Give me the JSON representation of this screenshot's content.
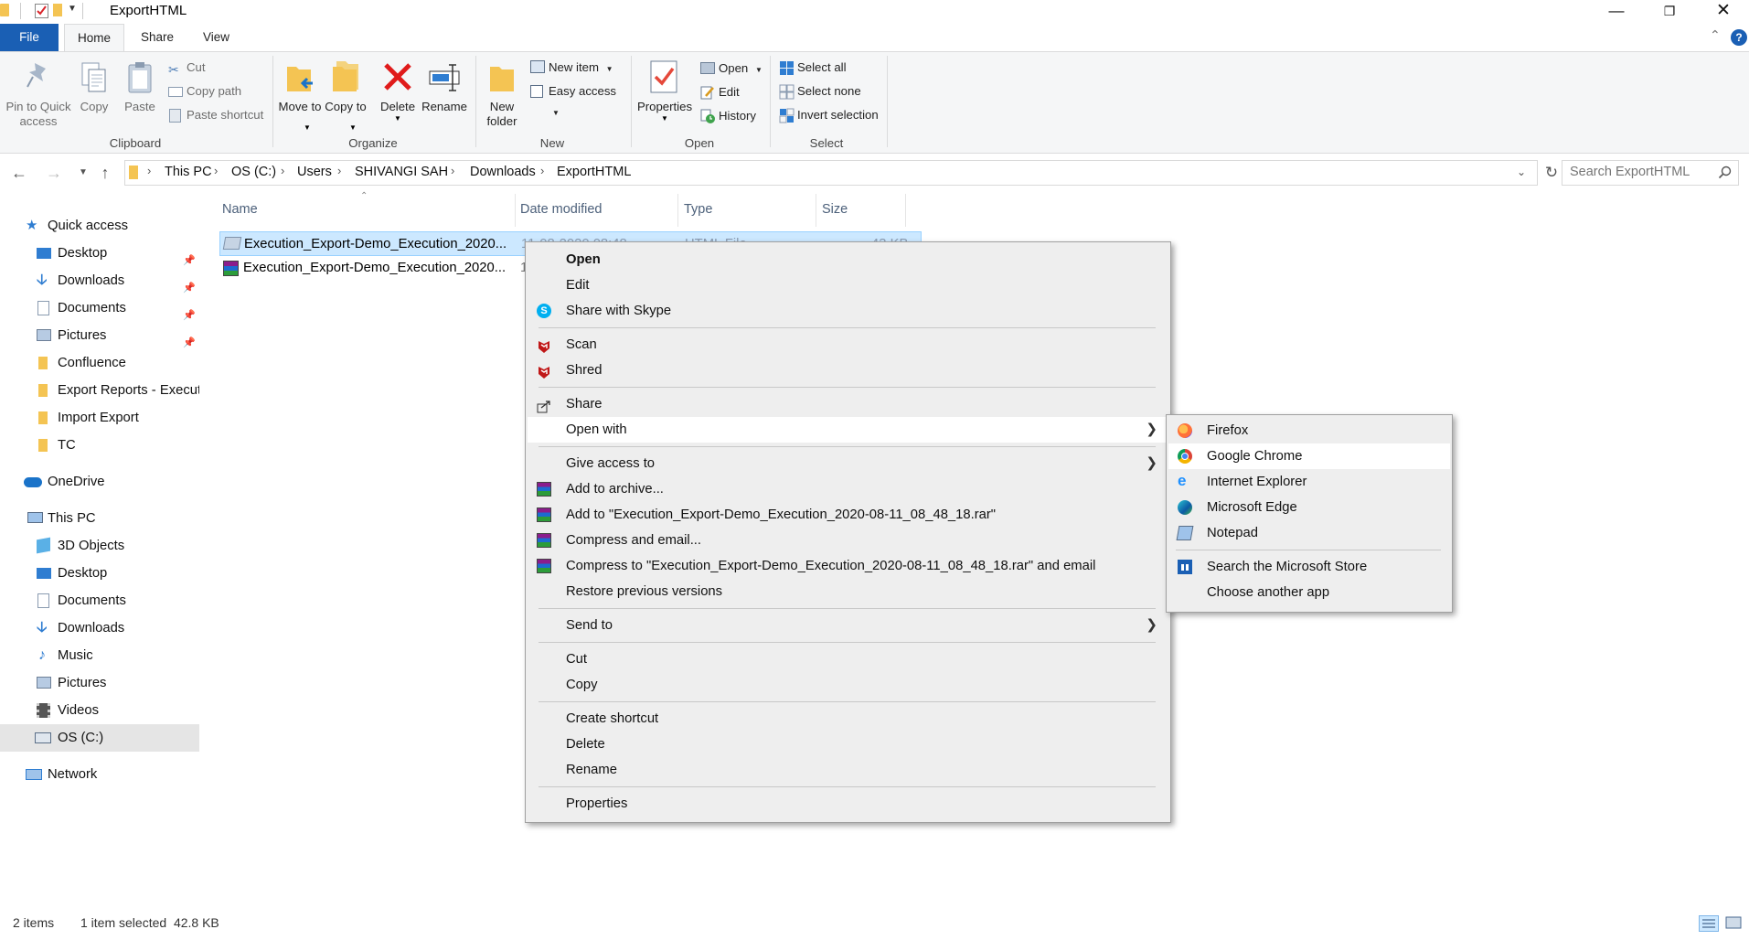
{
  "window": {
    "title": "ExportHTML"
  },
  "tabs": {
    "file": "File",
    "home": "Home",
    "share": "Share",
    "view": "View"
  },
  "ribbon": {
    "clipboard": {
      "pin_label": "Pin to Quick access",
      "copy_label": "Copy",
      "paste_label": "Paste",
      "cut_label": "Cut",
      "copy_path_label": "Copy path",
      "paste_shortcut_label": "Paste shortcut",
      "group_label": "Clipboard"
    },
    "organize": {
      "move_label": "Move to",
      "copy_label": "Copy to",
      "delete_label": "Delete",
      "rename_label": "Rename",
      "group_label": "Organize"
    },
    "new": {
      "new_folder_label": "New folder",
      "new_item_label": "New item",
      "easy_access_label": "Easy access",
      "group_label": "New"
    },
    "open": {
      "properties_label": "Properties",
      "open_label": "Open",
      "edit_label": "Edit",
      "history_label": "History",
      "group_label": "Open"
    },
    "select": {
      "select_all_label": "Select all",
      "select_none_label": "Select none",
      "invert_label": "Invert selection",
      "group_label": "Select"
    }
  },
  "address": {
    "crumbs": [
      "This PC",
      "OS (C:)",
      "Users",
      "SHIVANGI SAH",
      "Downloads",
      "ExportHTML"
    ],
    "search_placeholder": "Search ExportHTML"
  },
  "navpane": {
    "quick_access": "Quick access",
    "quick_items": [
      "Desktop",
      "Downloads",
      "Documents",
      "Pictures",
      "Confluence",
      "Export Reports - Execut",
      "Import Export",
      "TC"
    ],
    "onedrive": "OneDrive",
    "this_pc": "This PC",
    "pc_items": [
      "3D Objects",
      "Desktop",
      "Documents",
      "Downloads",
      "Music",
      "Pictures",
      "Videos",
      "OS (C:)"
    ],
    "network": "Network"
  },
  "filelist": {
    "columns": [
      "Name",
      "Date modified",
      "Type",
      "Size"
    ],
    "rows": [
      {
        "name": "Execution_Export-Demo_Execution_2020...",
        "date": "11-08-2020 08:48",
        "type": "HTML File",
        "size": "43 KB",
        "selected": true
      },
      {
        "name": "Execution_Export-Demo_Execution_2020...",
        "date": "1",
        "type": "",
        "size": "",
        "selected": false
      }
    ]
  },
  "context_menu": {
    "open": "Open",
    "edit": "Edit",
    "share_skype": "Share with Skype",
    "scan": "Scan",
    "shred": "Shred",
    "share": "Share",
    "open_with": "Open with",
    "give_access": "Give access to",
    "add_archive": "Add to archive...",
    "add_to_rar": "Add to \"Execution_Export-Demo_Execution_2020-08-11_08_48_18.rar\"",
    "compress_email": "Compress and email...",
    "compress_rar_email": "Compress to \"Execution_Export-Demo_Execution_2020-08-11_08_48_18.rar\" and email",
    "restore": "Restore previous versions",
    "send_to": "Send to",
    "cut": "Cut",
    "copy": "Copy",
    "create_shortcut": "Create shortcut",
    "delete": "Delete",
    "rename": "Rename",
    "properties": "Properties"
  },
  "open_with_menu": {
    "firefox": "Firefox",
    "chrome": "Google Chrome",
    "ie": "Internet Explorer",
    "edge": "Microsoft Edge",
    "notepad": "Notepad",
    "store": "Search the Microsoft Store",
    "other": "Choose another app"
  },
  "status": {
    "count": "2 items",
    "selection": "1 item selected  42.8 KB"
  },
  "colors": {
    "accent": "#1a5fb4",
    "selection": "#cce8ff",
    "menu_bg": "#eeeeee"
  }
}
